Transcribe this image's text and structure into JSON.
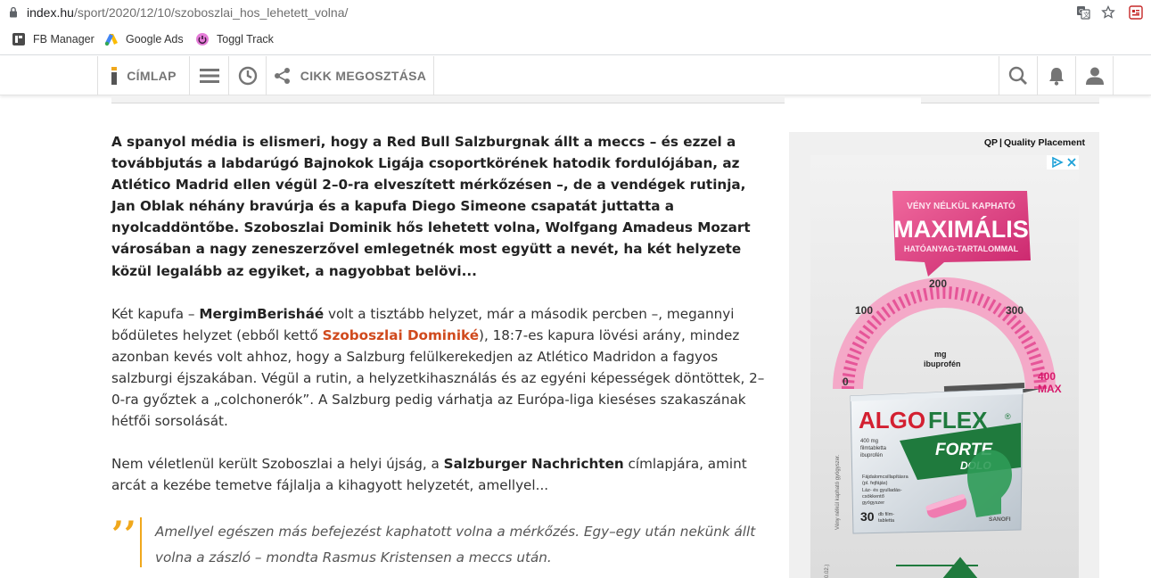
{
  "browser": {
    "url_host": "index.hu",
    "url_path": "/sport/2020/12/10/szoboszlai_hos_lehetett_volna/",
    "bookmarks": [
      {
        "label": "FB Manager"
      },
      {
        "label": "Google Ads"
      },
      {
        "label": "Toggl Track"
      }
    ]
  },
  "site_nav": {
    "home_label": "CÍMLAP",
    "share_label": "CIKK MEGOSZTÁSA"
  },
  "article": {
    "lead": "A spanyol média is elismeri, hogy a Red Bull Salzburgnak állt a meccs – és ezzel a továbbjutás a labdarúgó Bajnokok Ligája csoportkörének hatodik fordulójában, az Atlético Madrid ellen végül 2–0-ra elveszített mérkőzésen –, de a vendégek rutinja, Jan Oblak néhány bravúrja és a kapufa Diego Simeone csapatát juttatta a nyolcaddöntőbe. Szoboszlai Dominik hős lehetett volna, Wolfgang Amadeus Mozart városában a nagy zeneszerzővel emlegetnék most együtt a nevét, ha két helyzete közül legalább az egyiket, a nagyobbat belövi...",
    "p1_a": "Két kapufa – ",
    "p1_b": "MergimBerisháé",
    "p1_c": " volt a tisztább helyzet, már a második percben –, megannyi bődületes helyzet (ebből kettő ",
    "p1_d": "Szoboszlai Dominiké",
    "p1_e": "), 18:7-es kapura lövési arány, mindez azonban kevés volt ahhoz, hogy a Salzburg felülkerekedjen az Atlético Madridon a fagyos salzburgi éjszakában. Végül a rutin, a helyzetkihasználás és az egyéni képességek döntöttek, 2–0-ra győztek a „colchonerók”. A Salzburg pedig várhatja az Európa-liga kieséses szakaszának hétfői sorsolását.",
    "p2_a": "Nem véletlenül került Szoboszlai a helyi újság, a ",
    "p2_b": "Salzburger Nachrichten",
    "p2_c": " címlapjára, amint arcát a kezébe temetve fájlalja a kihagyott helyzetét, amellyel...",
    "quote": "Amellyel egészen más befejezést kaphatott volna a mérkőzés. Egy–egy után nekünk állt volna a zászló – mondta Rasmus Kristensen a meccs után.",
    "quote_mark": "’’"
  },
  "ad": {
    "qp_logo": "QP",
    "qp_label": "Quality Placement",
    "banner_line1": "VÉNY NÉLKÜL KAPHATÓ",
    "banner_line2": "MAXIMÁLIS",
    "banner_line3": "HATÓANYAG-TARTALOMMAL",
    "gauge_0": "0",
    "gauge_100": "100",
    "gauge_200": "200",
    "gauge_300": "300",
    "gauge_max1": "400",
    "gauge_max2": "MAX",
    "gauge_unit1": "mg",
    "gauge_unit2": "ibuprofén",
    "brand_a": "ALGO",
    "brand_b": "FLEX",
    "reg": "®",
    "sub1": "FORTE",
    "sub2": "DOLO",
    "dose1": "400 mg",
    "dose2": "filmtabletta",
    "dose3": "ibuprofén",
    "use1": "Fájdalomcsillapításra",
    "use2": "(pl. fejfájás)",
    "use3": "Láz- és gyulladás-",
    "use4": "csökkentő",
    "use5": "gyógyszer",
    "count": "30",
    "count_unit1": "db film-",
    "count_unit2": "tabletta",
    "maker": "SANOFI",
    "side_text": "Vény nélkül kapható gyógyszer.",
    "side_code": "0.02.)",
    "colors": {
      "accent": "#d04a1d",
      "quote": "#f0a81c",
      "brand_red": "#d32031",
      "brand_green": "#1f7a3d"
    }
  }
}
